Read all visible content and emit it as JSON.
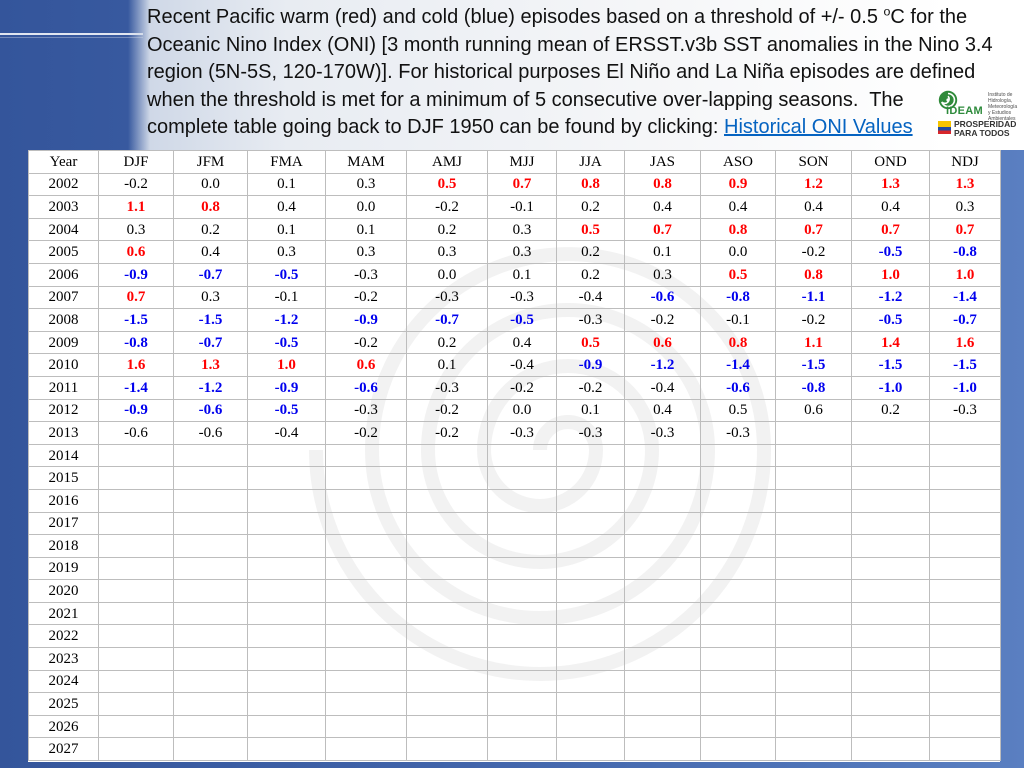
{
  "slide": {
    "description": {
      "line1_before": "Recent Pacific warm (red) and cold (blue) episodes based on a threshold of +/- 0.5 ",
      "line1_sup": "o",
      "line1_after": "C for the",
      "line2": "Oceanic Nino Index (ONI) [3 month running mean of ERSST.v3b SST anomalies in the Nino 3.4",
      "line3": "region (5N-5S, 120-170W)]. For historical purposes El Niño and La Niña episodes are defined",
      "line4": "when the threshold is met for a minimum of 5 consecutive over-lapping seasons.  The",
      "line5": "complete table going back to DJF 1950 can be found by clicking: ",
      "link_text": "Historical ONI Values"
    },
    "logos": {
      "ideam_name": "IDEAM",
      "ideam_subtitle": "Instituto de Hidrología, Meteorología y Estudios Ambientales",
      "prosperidad_line1": "PROSPERIDAD",
      "prosperidad_line2": "PARA TODOS"
    }
  },
  "colors": {
    "warm": "#ff0000",
    "cold": "#0000ee",
    "neutral": "#000000",
    "link": "#0563c1"
  },
  "table": {
    "columns": [
      "Year",
      "DJF",
      "JFM",
      "FMA",
      "MAM",
      "AMJ",
      "MJJ",
      "JJA",
      "JAS",
      "ASO",
      "SON",
      "OND",
      "NDJ"
    ],
    "rows": [
      {
        "year": "2002",
        "values": [
          "-0.2",
          "0.0",
          "0.1",
          "0.3",
          "0.5",
          "0.7",
          "0.8",
          "0.8",
          "0.9",
          "1.2",
          "1.3",
          "1.3"
        ],
        "episodes": [
          "",
          "",
          "",
          "",
          "warm",
          "warm",
          "warm",
          "warm",
          "warm",
          "warm",
          "warm",
          "warm"
        ]
      },
      {
        "year": "2003",
        "values": [
          "1.1",
          "0.8",
          "0.4",
          "0.0",
          "-0.2",
          "-0.1",
          "0.2",
          "0.4",
          "0.4",
          "0.4",
          "0.4",
          "0.3"
        ],
        "episodes": [
          "warm",
          "warm",
          "",
          "",
          "",
          "",
          "",
          "",
          "",
          "",
          "",
          ""
        ]
      },
      {
        "year": "2004",
        "values": [
          "0.3",
          "0.2",
          "0.1",
          "0.1",
          "0.2",
          "0.3",
          "0.5",
          "0.7",
          "0.8",
          "0.7",
          "0.7",
          "0.7"
        ],
        "episodes": [
          "",
          "",
          "",
          "",
          "",
          "",
          "warm",
          "warm",
          "warm",
          "warm",
          "warm",
          "warm"
        ]
      },
      {
        "year": "2005",
        "values": [
          "0.6",
          "0.4",
          "0.3",
          "0.3",
          "0.3",
          "0.3",
          "0.2",
          "0.1",
          "0.0",
          "-0.2",
          "-0.5",
          "-0.8"
        ],
        "episodes": [
          "warm",
          "",
          "",
          "",
          "",
          "",
          "",
          "",
          "",
          "",
          "cold",
          "cold"
        ]
      },
      {
        "year": "2006",
        "values": [
          "-0.9",
          "-0.7",
          "-0.5",
          "-0.3",
          "0.0",
          "0.1",
          "0.2",
          "0.3",
          "0.5",
          "0.8",
          "1.0",
          "1.0"
        ],
        "episodes": [
          "cold",
          "cold",
          "cold",
          "",
          "",
          "",
          "",
          "",
          "warm",
          "warm",
          "warm",
          "warm"
        ]
      },
      {
        "year": "2007",
        "values": [
          "0.7",
          "0.3",
          "-0.1",
          "-0.2",
          "-0.3",
          "-0.3",
          "-0.4",
          "-0.6",
          "-0.8",
          "-1.1",
          "-1.2",
          "-1.4"
        ],
        "episodes": [
          "warm",
          "",
          "",
          "",
          "",
          "",
          "",
          "cold",
          "cold",
          "cold",
          "cold",
          "cold"
        ]
      },
      {
        "year": "2008",
        "values": [
          "-1.5",
          "-1.5",
          "-1.2",
          "-0.9",
          "-0.7",
          "-0.5",
          "-0.3",
          "-0.2",
          "-0.1",
          "-0.2",
          "-0.5",
          "-0.7"
        ],
        "episodes": [
          "cold",
          "cold",
          "cold",
          "cold",
          "cold",
          "cold",
          "",
          "",
          "",
          "",
          "cold",
          "cold"
        ]
      },
      {
        "year": "2009",
        "values": [
          "-0.8",
          "-0.7",
          "-0.5",
          "-0.2",
          "0.2",
          "0.4",
          "0.5",
          "0.6",
          "0.8",
          "1.1",
          "1.4",
          "1.6"
        ],
        "episodes": [
          "cold",
          "cold",
          "cold",
          "",
          "",
          "",
          "warm",
          "warm",
          "warm",
          "warm",
          "warm",
          "warm"
        ]
      },
      {
        "year": "2010",
        "values": [
          "1.6",
          "1.3",
          "1.0",
          "0.6",
          "0.1",
          "-0.4",
          "-0.9",
          "-1.2",
          "-1.4",
          "-1.5",
          "-1.5",
          "-1.5"
        ],
        "episodes": [
          "warm",
          "warm",
          "warm",
          "warm",
          "",
          "",
          "cold",
          "cold",
          "cold",
          "cold",
          "cold",
          "cold"
        ]
      },
      {
        "year": "2011",
        "values": [
          "-1.4",
          "-1.2",
          "-0.9",
          "-0.6",
          "-0.3",
          "-0.2",
          "-0.2",
          "-0.4",
          "-0.6",
          "-0.8",
          "-1.0",
          "-1.0"
        ],
        "episodes": [
          "cold",
          "cold",
          "cold",
          "cold",
          "",
          "",
          "",
          "",
          "cold",
          "cold",
          "cold",
          "cold"
        ]
      },
      {
        "year": "2012",
        "values": [
          "-0.9",
          "-0.6",
          "-0.5",
          "-0.3",
          "-0.2",
          "0.0",
          "0.1",
          "0.4",
          "0.5",
          "0.6",
          "0.2",
          "-0.3"
        ],
        "episodes": [
          "cold",
          "cold",
          "cold",
          "",
          "",
          "",
          "",
          "",
          "",
          "",
          "",
          ""
        ]
      },
      {
        "year": "2013",
        "values": [
          "-0.6",
          "-0.6",
          "-0.4",
          "-0.2",
          "-0.2",
          "-0.3",
          "-0.3",
          "-0.3",
          "-0.3"
        ],
        "episodes": [
          "",
          "",
          "",
          "",
          "",
          "",
          "",
          "",
          ""
        ]
      },
      {
        "year": "2014",
        "values": [],
        "episodes": []
      },
      {
        "year": "2015",
        "values": [],
        "episodes": []
      },
      {
        "year": "2016",
        "values": [],
        "episodes": []
      },
      {
        "year": "2017",
        "values": [],
        "episodes": []
      },
      {
        "year": "2018",
        "values": [],
        "episodes": []
      },
      {
        "year": "2019",
        "values": [],
        "episodes": []
      },
      {
        "year": "2020",
        "values": [],
        "episodes": []
      },
      {
        "year": "2021",
        "values": [],
        "episodes": []
      },
      {
        "year": "2022",
        "values": [],
        "episodes": []
      },
      {
        "year": "2023",
        "values": [],
        "episodes": []
      },
      {
        "year": "2024",
        "values": [],
        "episodes": []
      },
      {
        "year": "2025",
        "values": [],
        "episodes": []
      },
      {
        "year": "2026",
        "values": [],
        "episodes": []
      },
      {
        "year": "2027",
        "values": [],
        "episodes": []
      }
    ]
  }
}
